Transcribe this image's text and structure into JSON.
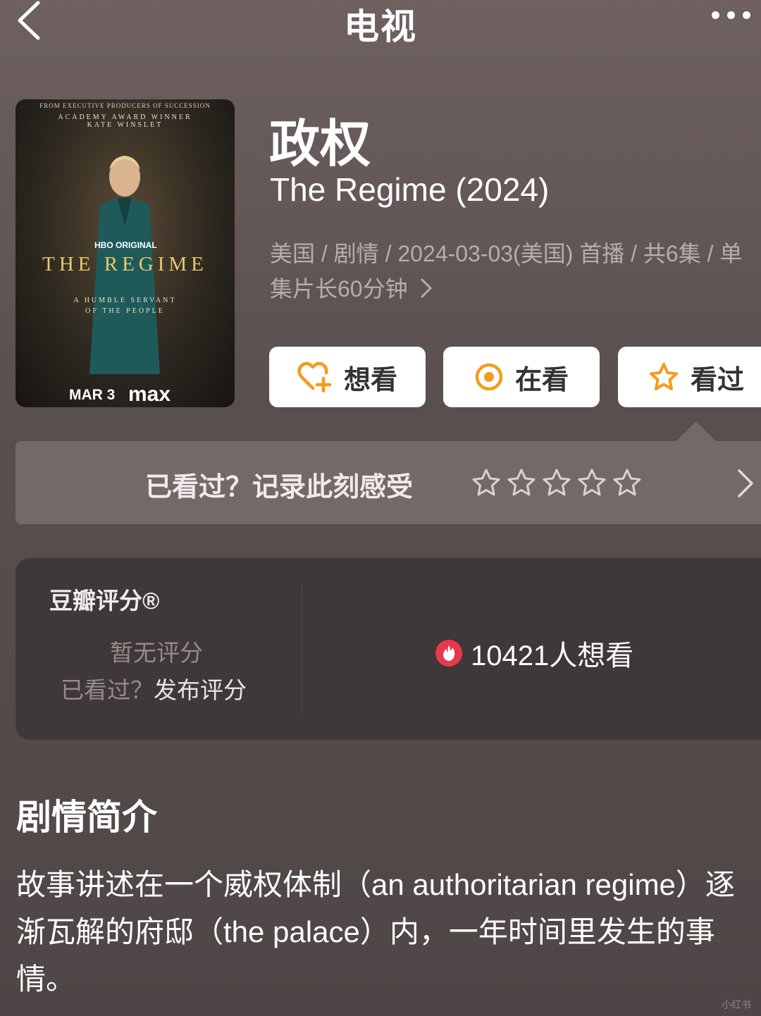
{
  "nav": {
    "title": "电视",
    "back_icon": "chevron-left-icon",
    "more_icon": "more-dots-icon"
  },
  "poster": {
    "top_line": "FROM EXECUTIVE PRODUCERS OF SUCCESSION",
    "credit_line1": "ACADEMY AWARD WINNER",
    "credit_line2": "KATE WINSLET",
    "network": "HBO ORIGINAL",
    "title": "THE REGIME",
    "tagline1": "A HUMBLE SERVANT",
    "tagline2": "OF THE PEOPLE",
    "date": "MAR 3",
    "platform": "max"
  },
  "title_cn": "政权",
  "title_en": "The Regime (2024)",
  "meta": "美国 / 剧情 / 2024-03-03(美国) 首播 / 共6集 / 单集片长60分钟",
  "actions": {
    "want": "想看",
    "watching": "在看",
    "watched": "看过",
    "accent": "#f59b1c"
  },
  "rate_prompt": {
    "label": "已看过？记录此刻感受",
    "stars": 5
  },
  "score": {
    "title": "豆瓣评分®",
    "none": "暂无评分",
    "prompt_prefix": "已看过？",
    "prompt_link": "发布评分",
    "want_count": "10421人想看",
    "fire_color": "#e8384f"
  },
  "synopsis": {
    "heading": "剧情简介",
    "text": "故事讲述在一个威权体制（an authoritarian regime）逐渐瓦解的府邸（the palace）内，一年时间里发生的事情。"
  },
  "watermark": "小红书"
}
